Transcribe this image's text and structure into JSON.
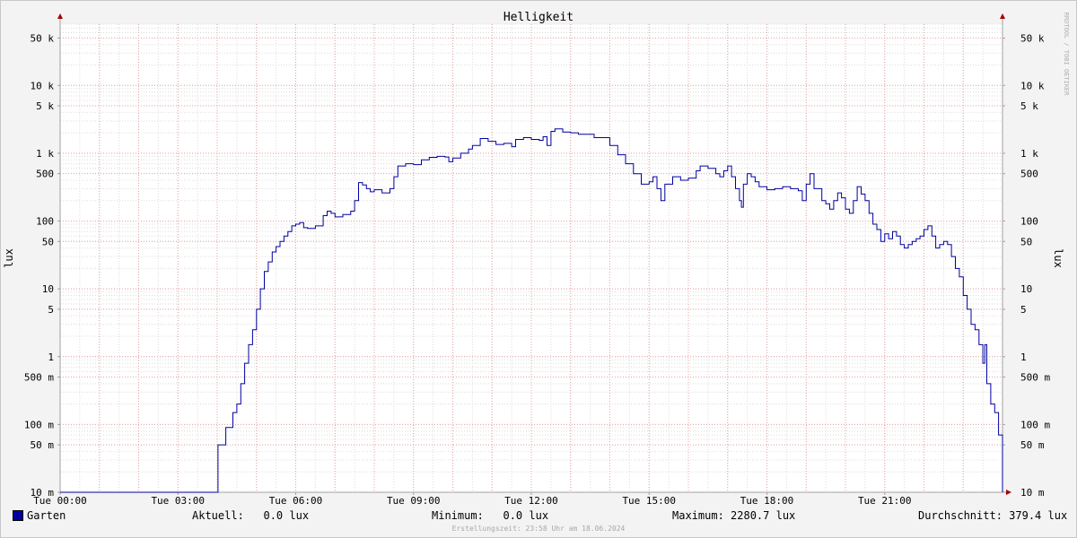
{
  "chart_data": {
    "type": "line",
    "title": "Helligkeit",
    "ylabel_left": "lux",
    "ylabel_right": "lux",
    "y_scale": "log",
    "ylim": [
      0.01,
      80000
    ],
    "xlim": [
      0,
      24
    ],
    "grid": true,
    "watermark": "RRDTOOL / TOBI OETIKER",
    "y_ticks": [
      {
        "value": 0.01,
        "label": "10 m"
      },
      {
        "value": 0.05,
        "label": "50 m"
      },
      {
        "value": 0.1,
        "label": "100 m"
      },
      {
        "value": 0.5,
        "label": "500 m"
      },
      {
        "value": 1,
        "label": "1"
      },
      {
        "value": 5,
        "label": "5"
      },
      {
        "value": 10,
        "label": "10"
      },
      {
        "value": 50,
        "label": "50"
      },
      {
        "value": 100,
        "label": "100"
      },
      {
        "value": 500,
        "label": "500"
      },
      {
        "value": 1000,
        "label": "1 k"
      },
      {
        "value": 5000,
        "label": "5 k"
      },
      {
        "value": 10000,
        "label": "10 k"
      },
      {
        "value": 50000,
        "label": "50 k"
      }
    ],
    "x_ticks": [
      {
        "value": 0,
        "label": "Tue 00:00"
      },
      {
        "value": 3,
        "label": "Tue 03:00"
      },
      {
        "value": 6,
        "label": "Tue 06:00"
      },
      {
        "value": 9,
        "label": "Tue 09:00"
      },
      {
        "value": 12,
        "label": "Tue 12:00"
      },
      {
        "value": 15,
        "label": "Tue 15:00"
      },
      {
        "value": 18,
        "label": "Tue 18:00"
      },
      {
        "value": 21,
        "label": "Tue 21:00"
      }
    ],
    "series": [
      {
        "name": "Garten",
        "color": "#0000a0",
        "points": [
          [
            0,
            0.01
          ],
          [
            4.0,
            0.01
          ],
          [
            4.02,
            0.05
          ],
          [
            4.2,
            0.05
          ],
          [
            4.22,
            0.09
          ],
          [
            4.35,
            0.09
          ],
          [
            4.4,
            0.15
          ],
          [
            4.5,
            0.2
          ],
          [
            4.6,
            0.4
          ],
          [
            4.7,
            0.8
          ],
          [
            4.8,
            1.5
          ],
          [
            4.9,
            2.5
          ],
          [
            5.0,
            5
          ],
          [
            5.1,
            10
          ],
          [
            5.2,
            18
          ],
          [
            5.3,
            25
          ],
          [
            5.4,
            35
          ],
          [
            5.5,
            42
          ],
          [
            5.6,
            50
          ],
          [
            5.7,
            60
          ],
          [
            5.8,
            70
          ],
          [
            5.9,
            85
          ],
          [
            6.0,
            90
          ],
          [
            6.1,
            95
          ],
          [
            6.2,
            80
          ],
          [
            6.3,
            78
          ],
          [
            6.5,
            85
          ],
          [
            6.7,
            120
          ],
          [
            6.8,
            140
          ],
          [
            6.9,
            130
          ],
          [
            7.0,
            115
          ],
          [
            7.2,
            125
          ],
          [
            7.4,
            140
          ],
          [
            7.5,
            200
          ],
          [
            7.6,
            370
          ],
          [
            7.7,
            340
          ],
          [
            7.8,
            300
          ],
          [
            7.9,
            270
          ],
          [
            8.0,
            290
          ],
          [
            8.2,
            260
          ],
          [
            8.4,
            300
          ],
          [
            8.5,
            450
          ],
          [
            8.6,
            650
          ],
          [
            8.8,
            700
          ],
          [
            9.0,
            680
          ],
          [
            9.2,
            800
          ],
          [
            9.4,
            870
          ],
          [
            9.6,
            900
          ],
          [
            9.8,
            880
          ],
          [
            9.9,
            750
          ],
          [
            10.0,
            850
          ],
          [
            10.2,
            1000
          ],
          [
            10.4,
            1150
          ],
          [
            10.5,
            1300
          ],
          [
            10.7,
            1650
          ],
          [
            10.9,
            1500
          ],
          [
            11.1,
            1350
          ],
          [
            11.3,
            1400
          ],
          [
            11.5,
            1250
          ],
          [
            11.6,
            1600
          ],
          [
            11.8,
            1700
          ],
          [
            12.0,
            1600
          ],
          [
            12.2,
            1550
          ],
          [
            12.3,
            1750
          ],
          [
            12.4,
            1300
          ],
          [
            12.5,
            2100
          ],
          [
            12.6,
            2280
          ],
          [
            12.8,
            2050
          ],
          [
            13.0,
            2000
          ],
          [
            13.2,
            1900
          ],
          [
            13.4,
            1900
          ],
          [
            13.6,
            1700
          ],
          [
            13.8,
            1700
          ],
          [
            14.0,
            1300
          ],
          [
            14.2,
            950
          ],
          [
            14.4,
            700
          ],
          [
            14.6,
            500
          ],
          [
            14.8,
            350
          ],
          [
            15.0,
            380
          ],
          [
            15.1,
            450
          ],
          [
            15.2,
            300
          ],
          [
            15.3,
            200
          ],
          [
            15.4,
            350
          ],
          [
            15.6,
            450
          ],
          [
            15.8,
            400
          ],
          [
            16.0,
            430
          ],
          [
            16.2,
            550
          ],
          [
            16.3,
            650
          ],
          [
            16.5,
            600
          ],
          [
            16.7,
            500
          ],
          [
            16.8,
            450
          ],
          [
            16.9,
            550
          ],
          [
            17.0,
            650
          ],
          [
            17.1,
            450
          ],
          [
            17.2,
            300
          ],
          [
            17.3,
            200
          ],
          [
            17.35,
            160
          ],
          [
            17.4,
            350
          ],
          [
            17.5,
            500
          ],
          [
            17.6,
            450
          ],
          [
            17.7,
            380
          ],
          [
            17.8,
            320
          ],
          [
            18.0,
            290
          ],
          [
            18.2,
            300
          ],
          [
            18.4,
            320
          ],
          [
            18.6,
            300
          ],
          [
            18.8,
            280
          ],
          [
            18.9,
            200
          ],
          [
            19.0,
            350
          ],
          [
            19.1,
            500
          ],
          [
            19.2,
            300
          ],
          [
            19.4,
            200
          ],
          [
            19.5,
            180
          ],
          [
            19.6,
            150
          ],
          [
            19.7,
            200
          ],
          [
            19.8,
            260
          ],
          [
            19.9,
            220
          ],
          [
            20.0,
            150
          ],
          [
            20.1,
            130
          ],
          [
            20.2,
            200
          ],
          [
            20.3,
            320
          ],
          [
            20.4,
            250
          ],
          [
            20.5,
            200
          ],
          [
            20.6,
            130
          ],
          [
            20.7,
            90
          ],
          [
            20.8,
            75
          ],
          [
            20.9,
            50
          ],
          [
            21.0,
            65
          ],
          [
            21.1,
            55
          ],
          [
            21.2,
            70
          ],
          [
            21.3,
            60
          ],
          [
            21.4,
            45
          ],
          [
            21.5,
            40
          ],
          [
            21.6,
            45
          ],
          [
            21.7,
            50
          ],
          [
            21.8,
            55
          ],
          [
            21.9,
            60
          ],
          [
            22.0,
            75
          ],
          [
            22.1,
            85
          ],
          [
            22.2,
            60
          ],
          [
            22.3,
            40
          ],
          [
            22.4,
            45
          ],
          [
            22.5,
            50
          ],
          [
            22.6,
            45
          ],
          [
            22.7,
            30
          ],
          [
            22.8,
            20
          ],
          [
            22.9,
            15
          ],
          [
            23.0,
            8
          ],
          [
            23.1,
            5
          ],
          [
            23.2,
            3
          ],
          [
            23.3,
            2.5
          ],
          [
            23.4,
            1.5
          ],
          [
            23.5,
            0.8
          ],
          [
            23.55,
            1.5
          ],
          [
            23.6,
            0.4
          ],
          [
            23.7,
            0.2
          ],
          [
            23.8,
            0.15
          ],
          [
            23.9,
            0.07
          ],
          [
            24.0,
            0.05
          ],
          [
            24.1,
            0.05
          ],
          [
            24.2,
            0.05
          ],
          [
            24.22,
            0.01
          ],
          [
            24.8,
            0.01
          ]
        ]
      }
    ]
  },
  "legend": {
    "series_name": "Garten",
    "aktuell": "Aktuell:   0.0 lux",
    "minimum": "Minimum:   0.0 lux",
    "maximum": "Maximum: 2280.7 lux",
    "durchschnitt": "Durchschnitt: 379.4 lux"
  },
  "footer_note": "Erstellungszeit: 23:58 Uhr am 18.06.2024"
}
